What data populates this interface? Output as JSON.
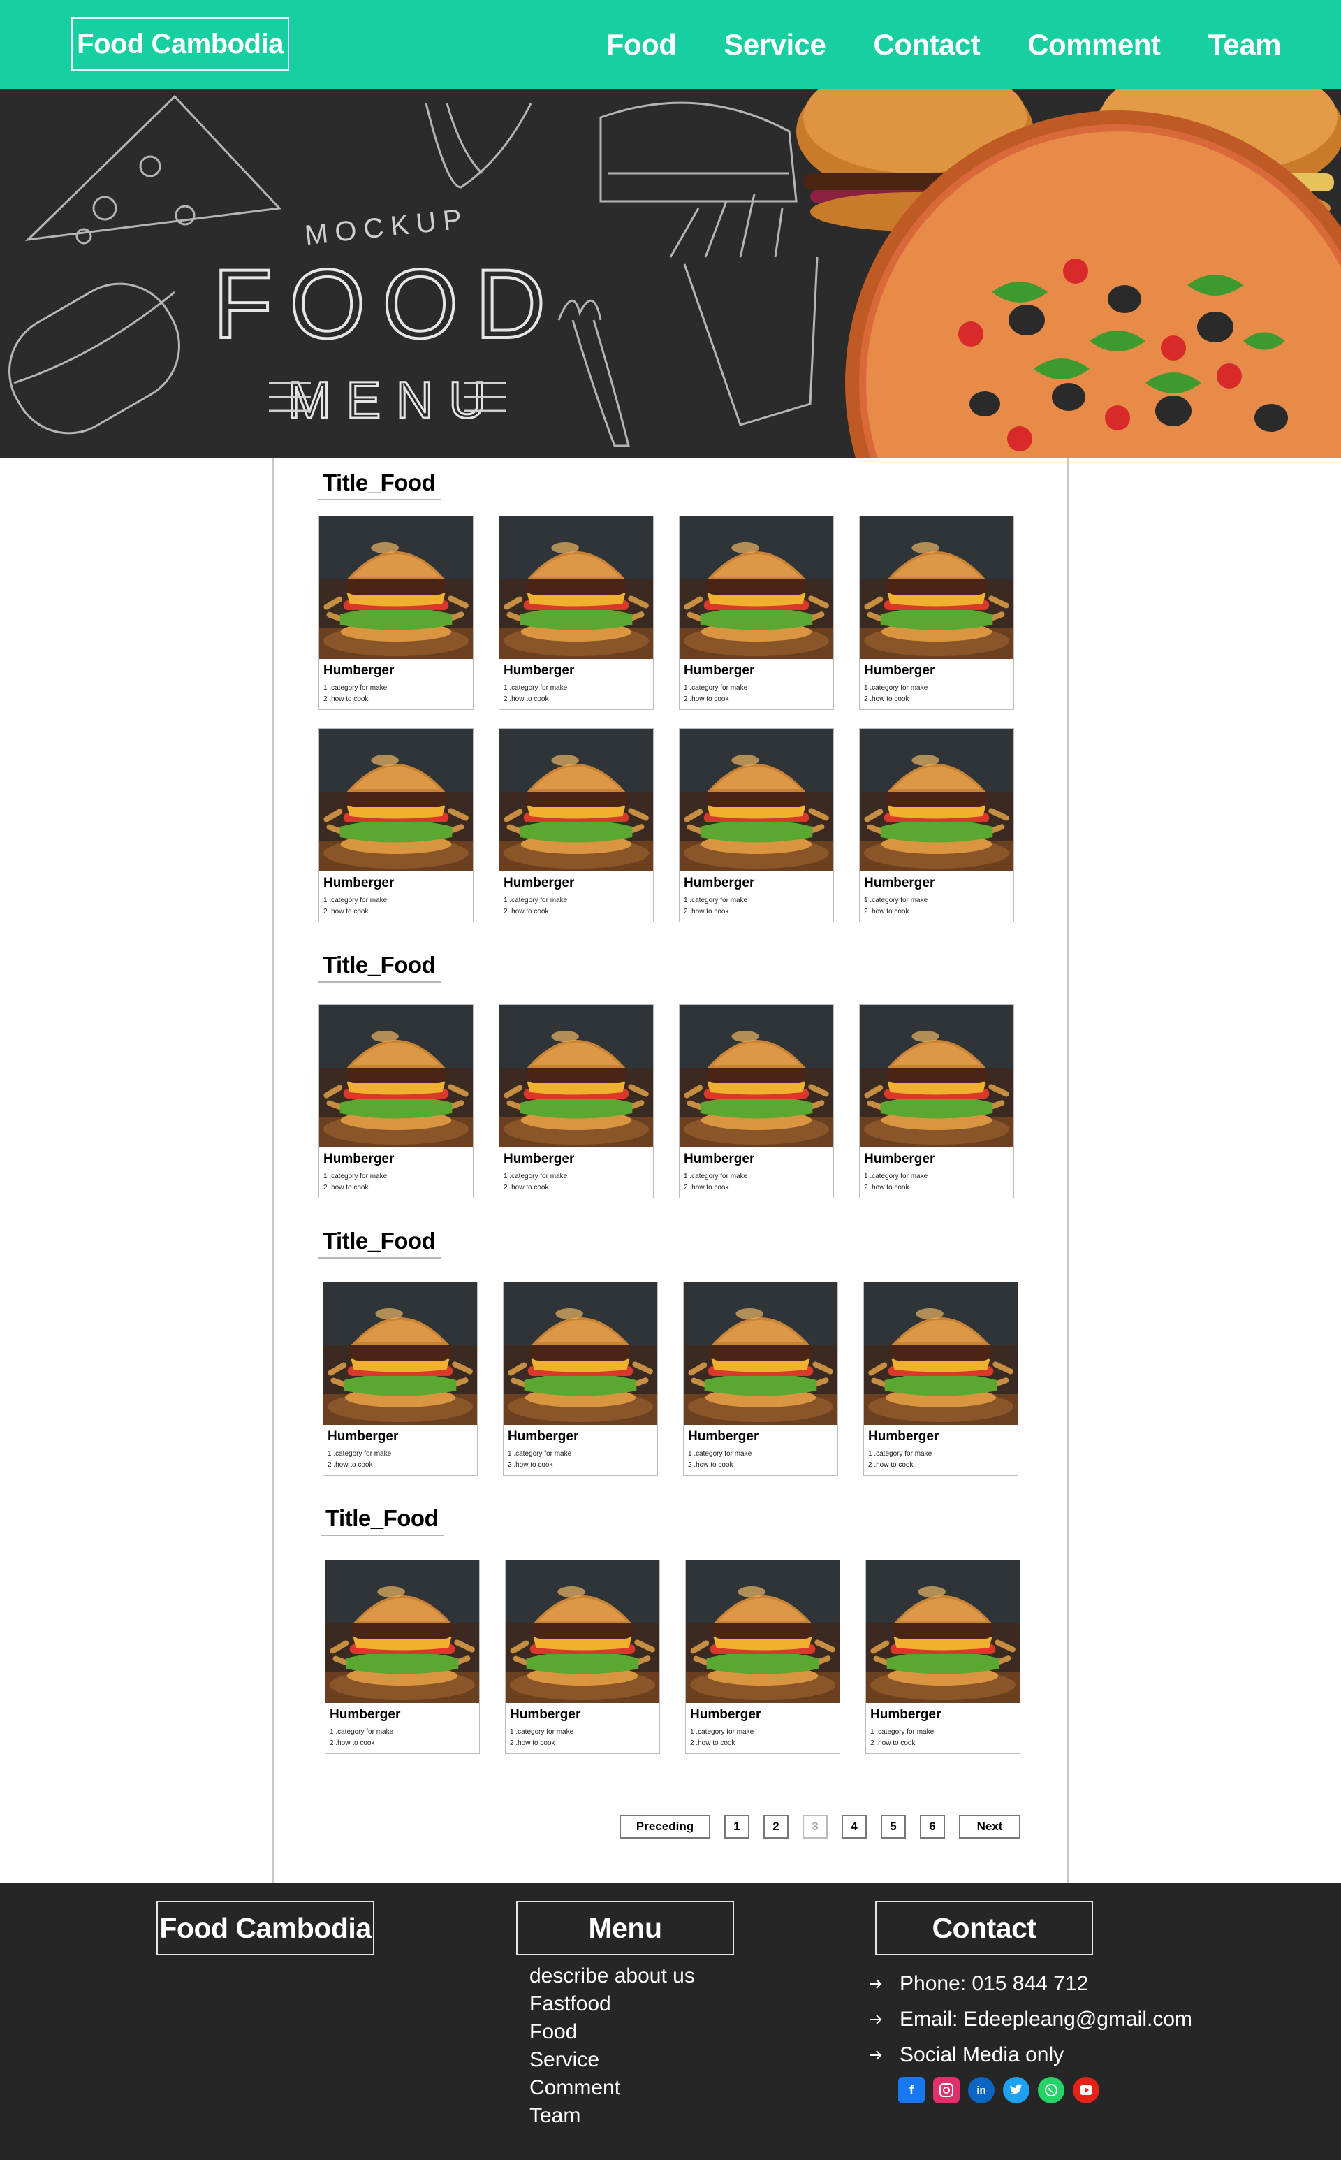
{
  "header": {
    "logo": "Food Cambodia",
    "nav": [
      "Food",
      "Service",
      "Contact",
      "Comment",
      "Team"
    ]
  },
  "hero": {
    "mockup_label": "MOCKUP",
    "big_word": "FOOD",
    "sub_word": "MENU"
  },
  "sections": [
    {
      "title": "Title_Food",
      "rows": [
        [
          {
            "name": "Humberger",
            "line1": "1 .category for make",
            "line2": "2 .how to cook"
          },
          {
            "name": "Humberger",
            "line1": "1 .category for make",
            "line2": "2 .how to cook"
          },
          {
            "name": "Humberger",
            "line1": "1 .category for make",
            "line2": "2 .how to cook"
          },
          {
            "name": "Humberger",
            "line1": "1 .category for make",
            "line2": "2 .how to cook"
          }
        ],
        [
          {
            "name": "Humberger",
            "line1": "1 .category for make",
            "line2": "2 .how to cook"
          },
          {
            "name": "Humberger",
            "line1": "1 .category for make",
            "line2": "2 .how to cook"
          },
          {
            "name": "Humberger",
            "line1": "1 .category for make",
            "line2": "2 .how to cook"
          },
          {
            "name": "Humberger",
            "line1": "1 .category for make",
            "line2": "2 .how to cook"
          }
        ]
      ]
    },
    {
      "title": "Title_Food",
      "rows": [
        [
          {
            "name": "Humberger",
            "line1": "1 .category for make",
            "line2": "2 .how to cook"
          },
          {
            "name": "Humberger",
            "line1": "1 .category for make",
            "line2": "2 .how to cook"
          },
          {
            "name": "Humberger",
            "line1": "1 .category for make",
            "line2": "2 .how to cook"
          },
          {
            "name": "Humberger",
            "line1": "1 .category for make",
            "line2": "2 .how to cook"
          }
        ]
      ]
    },
    {
      "title": "Title_Food",
      "rows": [
        [
          {
            "name": "Humberger",
            "line1": "1 .category for make",
            "line2": "2 .how to cook"
          },
          {
            "name": "Humberger",
            "line1": "1 .category for make",
            "line2": "2 .how to cook"
          },
          {
            "name": "Humberger",
            "line1": "1 .category for make",
            "line2": "2 .how to cook"
          },
          {
            "name": "Humberger",
            "line1": "1 .category for make",
            "line2": "2 .how to cook"
          }
        ]
      ]
    },
    {
      "title": "Title_Food",
      "rows": [
        [
          {
            "name": "Humberger",
            "line1": "1 .category for make",
            "line2": "2 .how to cook"
          },
          {
            "name": "Humberger",
            "line1": "1 .category for make",
            "line2": "2 .how to cook"
          },
          {
            "name": "Humberger",
            "line1": "1 .category for make",
            "line2": "2 .how to cook"
          },
          {
            "name": "Humberger",
            "line1": "1 .category for make",
            "line2": "2 .how to cook"
          }
        ]
      ]
    }
  ],
  "pagination": {
    "prev": "Preceding",
    "pages": [
      "1",
      "2",
      "3",
      "4",
      "5",
      "6"
    ],
    "current": "3",
    "next": "Next"
  },
  "footer": {
    "logo": "Food Cambodia",
    "menu_title": "Menu",
    "menu_items": [
      "describe about us",
      "Fastfood",
      "Food",
      "Service",
      "Comment",
      "Team"
    ],
    "contact_title": "Contact",
    "phone": "Phone: 015 844 712",
    "email": "Email: Edeepleang@gmail.com",
    "social": "Social Media only",
    "social_icons": [
      "facebook-icon",
      "instagram-icon",
      "linkedin-icon",
      "twitter-icon",
      "whatsapp-icon",
      "youtube-icon"
    ]
  },
  "colors": {
    "header_bg": "#17cfa0",
    "footer_bg": "#262626",
    "hero_bg": "#2a2a2a"
  }
}
